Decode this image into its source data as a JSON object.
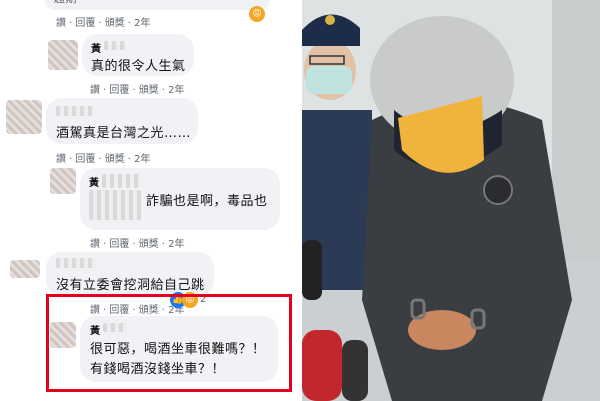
{
  "left_panel": {
    "top_partial_text": "超期",
    "comments": [
      {
        "name": "黃",
        "lines": [
          "真的很令人生氣"
        ],
        "actions": [
          "讚",
          "回覆",
          "頒獎",
          "2年"
        ]
      },
      {
        "name": "",
        "lines": [
          "酒駕真是台灣之光……"
        ],
        "actions": [
          "讚",
          "回覆",
          "頒獎",
          "2年"
        ]
      },
      {
        "name": "黃",
        "lines": [
          "詐騙也是啊，毒品也"
        ],
        "actions": [
          "讚",
          "回覆",
          "頒獎",
          "2年"
        ]
      },
      {
        "name": "",
        "lines": [
          "沒有立委會挖洞給自己跳"
        ],
        "actions": [
          "讚",
          "回覆",
          "頒獎",
          "2年"
        ]
      },
      {
        "name": "黃",
        "lines": [
          "很可惡，喝酒坐車很難嗎？！",
          "有錢喝酒沒錢坐車？！"
        ]
      }
    ],
    "top_actions": [
      "讚",
      "回覆",
      "頒獎",
      "2年"
    ],
    "reactions": {
      "angry": "😡",
      "like": "👍"
    },
    "highlight_color": "#e1001d"
  },
  "right_panel": {
    "description": "photo of police escorting handcuffed suspect"
  }
}
